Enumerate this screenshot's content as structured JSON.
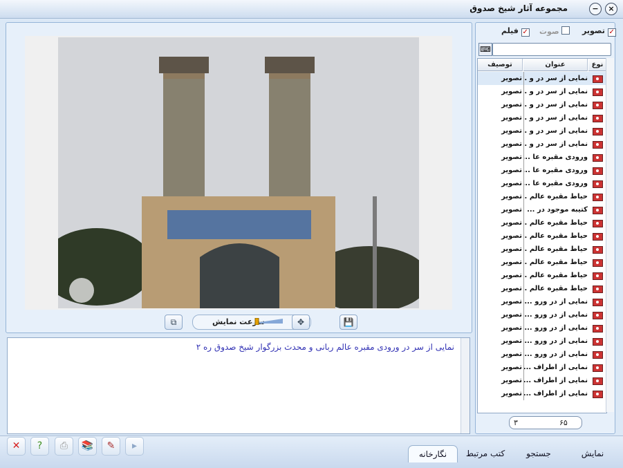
{
  "window": {
    "title": "مجموعه آثار شیخ صدوق",
    "minimize_icon": "−",
    "close_icon": "×"
  },
  "viewer": {
    "speed_label": "سرعت نمایش",
    "description": "نمایی از سر در ورودی مقبره عالم ربانی و محدث بزرگوار شیخ صدوق ره ۲"
  },
  "filters": {
    "image": {
      "label": "تصویر",
      "checked": true
    },
    "audio": {
      "label": "صوت",
      "checked": false
    },
    "film": {
      "label": "فیلم",
      "checked": true
    }
  },
  "grid": {
    "headers": {
      "type": "نوع",
      "title": "عنوان",
      "desc": "توصیف"
    },
    "rows": [
      {
        "title": "نمایی از سر در و ...",
        "desc": "تصویر"
      },
      {
        "title": "نمایی از سر در و ...",
        "desc": "تصویر"
      },
      {
        "title": "نمایی از سر در و ...",
        "desc": "تصویر"
      },
      {
        "title": "نمایی از سر در و ...",
        "desc": "تصویر"
      },
      {
        "title": "نمایی از سر در و ...",
        "desc": "تصویر"
      },
      {
        "title": "نمایی از سر در و ...",
        "desc": "تصویر"
      },
      {
        "title": "ورودی مقبره عا ...",
        "desc": "تصویر"
      },
      {
        "title": "ورودی مقبره عا ...",
        "desc": "تصویر"
      },
      {
        "title": "ورودی مقبره عا ...",
        "desc": "تصویر"
      },
      {
        "title": "حیاط مقبره عالم ...",
        "desc": "تصویر"
      },
      {
        "title": "کتیبه موجود در ...",
        "desc": "تصویر"
      },
      {
        "title": "حیاط مقبره عالم ...",
        "desc": "تصویر"
      },
      {
        "title": "حیاط مقبره عالم ...",
        "desc": "تصویر"
      },
      {
        "title": "حیاط مقبره عالم ...",
        "desc": "تصویر"
      },
      {
        "title": "حیاط مقبره عالم ...",
        "desc": "تصویر"
      },
      {
        "title": "حیاط مقبره عالم ...",
        "desc": "تصویر"
      },
      {
        "title": "حیاط مقبره عالم ...",
        "desc": "تصویر"
      },
      {
        "title": "نمایی از در ورو ...",
        "desc": "تصویر"
      },
      {
        "title": "نمایی از در ورو ...",
        "desc": "تصویر"
      },
      {
        "title": "نمایی از در ورو ...",
        "desc": "تصویر"
      },
      {
        "title": "نمایی از در ورو ...",
        "desc": "تصویر"
      },
      {
        "title": "نمایی از در ورو ...",
        "desc": "تصویر"
      },
      {
        "title": "نمایی از اطراف ...",
        "desc": "تصویر"
      },
      {
        "title": "نمایی از اطراف ...",
        "desc": "تصویر"
      },
      {
        "title": "نمایی از اطراف ...",
        "desc": "تصویر"
      }
    ]
  },
  "pager": {
    "total": "۶۵",
    "current": "۳"
  },
  "tabs": [
    {
      "label": "نمایش"
    },
    {
      "label": "جستجو"
    },
    {
      "label": "کتب مرتبط"
    },
    {
      "label": "نگارخانه"
    }
  ],
  "actions": {
    "close": "✕",
    "help": "?",
    "print": "⎙",
    "books": "📚",
    "edit": "✎",
    "next": "▸"
  },
  "colors": {
    "accent": "#3232b4",
    "frame": "#95b4d7"
  }
}
